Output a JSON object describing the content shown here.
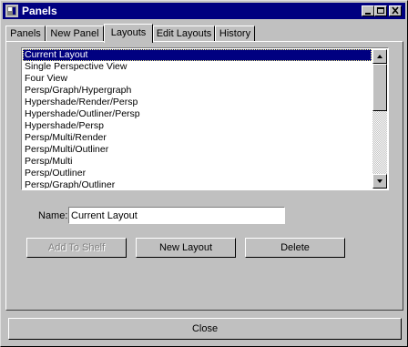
{
  "window": {
    "title": "Panels",
    "buttons": {
      "minimize": "minimize",
      "maximize": "maximize",
      "close": "close"
    }
  },
  "tabs": [
    {
      "label": "Panels"
    },
    {
      "label": "New Panel"
    },
    {
      "label": "Layouts"
    },
    {
      "label": "Edit Layouts"
    },
    {
      "label": "History"
    }
  ],
  "active_tab": "Layouts",
  "layouts_list": {
    "selected": "Current Layout",
    "items": [
      "Current Layout",
      "Single Perspective View",
      "Four View",
      "Persp/Graph/Hypergraph",
      "Hypershade/Render/Persp",
      "Hypershade/Outliner/Persp",
      "Hypershade/Persp",
      "Persp/Multi/Render",
      "Persp/Multi/Outliner",
      "Persp/Multi",
      "Persp/Outliner",
      "Persp/Graph/Outliner"
    ]
  },
  "name_field": {
    "label": "Name:",
    "value": "Current Layout"
  },
  "actions": {
    "add_to_shelf": "Add To Shelf",
    "new_layout": "New Layout",
    "delete": "Delete"
  },
  "footer": {
    "close": "Close"
  },
  "colors": {
    "title_bar": "#000080",
    "face": "#c0c0c0",
    "selection": "#000080"
  }
}
